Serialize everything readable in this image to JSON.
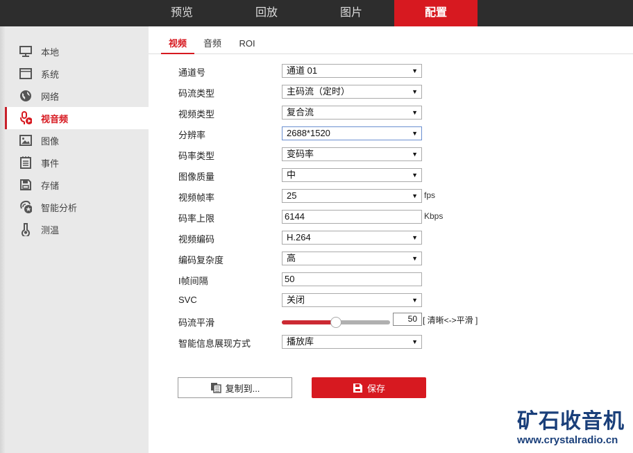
{
  "topnav": {
    "items": [
      "预览",
      "回放",
      "图片",
      "配置"
    ],
    "active": 3
  },
  "sidebar": {
    "items": [
      {
        "label": "本地",
        "icon": "monitor-icon"
      },
      {
        "label": "系统",
        "icon": "window-icon"
      },
      {
        "label": "网络",
        "icon": "globe-icon"
      },
      {
        "label": "视音频",
        "icon": "mic-icon"
      },
      {
        "label": "图像",
        "icon": "image-icon"
      },
      {
        "label": "事件",
        "icon": "calendar-icon"
      },
      {
        "label": "存储",
        "icon": "floppy-icon"
      },
      {
        "label": "智能分析",
        "icon": "smart-analysis-icon"
      },
      {
        "label": "测温",
        "icon": "thermometer-icon"
      }
    ],
    "active": 3
  },
  "subtabs": [
    "视频",
    "音频",
    "ROI"
  ],
  "form": {
    "channel": {
      "label": "通道号",
      "value": "通道 01"
    },
    "stream_type": {
      "label": "码流类型",
      "value": "主码流（定时）"
    },
    "video_type": {
      "label": "视频类型",
      "value": "复合流"
    },
    "resolution": {
      "label": "分辨率",
      "value": "2688*1520"
    },
    "bitrate_type": {
      "label": "码率类型",
      "value": "变码率"
    },
    "quality": {
      "label": "图像质量",
      "value": "中"
    },
    "framerate": {
      "label": "视频帧率",
      "value": "25",
      "unit": "fps"
    },
    "max_bitrate": {
      "label": "码率上限",
      "value": "6144",
      "unit": "Kbps"
    },
    "encoding": {
      "label": "视频编码",
      "value": "H.264"
    },
    "complexity": {
      "label": "编码复杂度",
      "value": "高"
    },
    "i_frame": {
      "label": "I帧间隔",
      "value": "50"
    },
    "svc": {
      "label": "SVC",
      "value": "关闭"
    },
    "smoothing": {
      "label": "码流平滑",
      "value": "50",
      "percent": 50,
      "hint": "[ 清晰<->平滑 ]"
    },
    "smart_info": {
      "label": "智能信息展现方式",
      "value": "播放库"
    }
  },
  "buttons": {
    "copy": "复制到...",
    "save": "保存"
  },
  "watermark": {
    "title": "矿石收音机",
    "url": "www.crystalradio.cn"
  },
  "colors": {
    "accent": "#d71920",
    "topbar": "#2d2d2d",
    "sidebar": "#e9e9e9"
  }
}
